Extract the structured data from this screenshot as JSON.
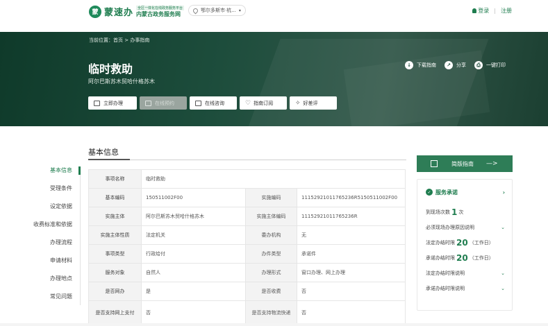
{
  "header": {
    "logo_mark": "蒙",
    "logo_text": "蒙速办",
    "logo_sub_top": "全区一体化在线政务服务平台",
    "logo_sub_bottom": "内蒙古政务服务网",
    "location": "鄂尔多斯市·杭...",
    "login": "登录",
    "register": "注册"
  },
  "hero": {
    "breadcrumb_label": "当前位置：",
    "breadcrumb_home": "首页",
    "breadcrumb_current": "办事指南",
    "title": "临时救助",
    "subtitle": "阿尔巴斯苏木贸哈什格苏木",
    "actions": [
      {
        "label": "下载指南",
        "icon": "download-icon"
      },
      {
        "label": "分享",
        "icon": "share-icon"
      },
      {
        "label": "一键打印",
        "icon": "print-icon"
      }
    ],
    "buttons": [
      {
        "label": "立即办理",
        "disabled": false
      },
      {
        "label": "在线预约",
        "disabled": true
      },
      {
        "label": "在线咨询",
        "disabled": false
      },
      {
        "label": "指南订阅",
        "disabled": false
      },
      {
        "label": "好差评",
        "disabled": false
      }
    ]
  },
  "section": {
    "title": "基本信息"
  },
  "left_nav": [
    {
      "label": "基本信息",
      "active": true
    },
    {
      "label": "受理条件",
      "active": false
    },
    {
      "label": "设定依据",
      "active": false
    },
    {
      "label": "收费标准和依据",
      "active": false
    },
    {
      "label": "办理流程",
      "active": false
    },
    {
      "label": "申请材料",
      "active": false
    },
    {
      "label": "办理地点",
      "active": false
    },
    {
      "label": "常见问题",
      "active": false
    }
  ],
  "table": {
    "single": {
      "k": "事项名称",
      "v": "临时救助"
    },
    "rows": [
      {
        "k1": "基本编码",
        "v1": "150511002F00",
        "k2": "实施编码",
        "v2": "11152921011765236R5150511002F00"
      },
      {
        "k1": "实施主体",
        "v1": "阿尔巴斯苏木贸哈什格苏木",
        "k2": "实施主体编码",
        "v2": "11152921011765236R"
      },
      {
        "k1": "实施主体性质",
        "v1": "法定机关",
        "k2": "委办机构",
        "v2": "无"
      },
      {
        "k1": "事项类型",
        "v1": "行政给付",
        "k2": "办件类型",
        "v2": "承诺件"
      },
      {
        "k1": "服务对象",
        "v1": "自然人",
        "k2": "办理形式",
        "v2": "窗口办理、网上办理"
      },
      {
        "k1": "是否网办",
        "v1": "是",
        "k2": "是否收费",
        "v2": "否"
      },
      {
        "k1": "是否支持网上支付",
        "v1": "否",
        "k2": "是否支持物流快递",
        "v2": "否"
      }
    ]
  },
  "right": {
    "guide_button": "简版指南",
    "guide_arrow": "—>",
    "promise_title": "服务承诺",
    "visits_label": "到现场次数",
    "visits_value": "1",
    "visits_unit": "次",
    "need_visit": "必须现场办理原因说明",
    "legal_limit_label": "法定办结时限",
    "legal_limit_value": "20",
    "legal_limit_unit": "（工作日）",
    "promise_limit_label": "承诺办结时限",
    "promise_limit_value": "20",
    "promise_limit_unit": "（工作日）",
    "legal_note": "法定办结时限说明",
    "promise_note": "承诺办结时限说明"
  }
}
